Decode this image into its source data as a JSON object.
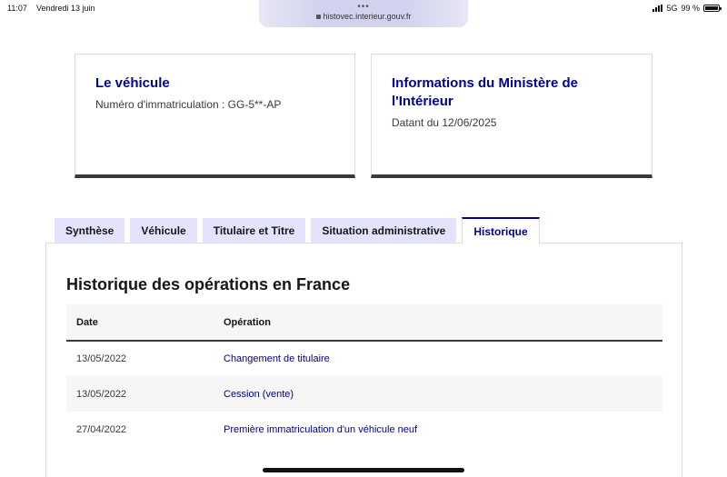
{
  "status_bar": {
    "time": "11:07",
    "date": "Vendredi 13 juin",
    "network": "5G",
    "battery": "99 %",
    "battery_level": 0.99
  },
  "browser": {
    "url": "histovec.interieur.gouv.fr",
    "dots": "•••"
  },
  "cards": {
    "vehicle": {
      "title": "Le véhicule",
      "text": "Numéro d'immatriculation : GG-5**-AP"
    },
    "ministry": {
      "title": "Informations du Ministère de l'Intérieur",
      "text": "Datant du 12/06/2025"
    }
  },
  "tabs": [
    {
      "label": "Synthèse",
      "active": false
    },
    {
      "label": "Véhicule",
      "active": false
    },
    {
      "label": "Titulaire et Titre",
      "active": false
    },
    {
      "label": "Situation administrative",
      "active": false
    },
    {
      "label": "Historique",
      "active": true
    }
  ],
  "history": {
    "title": "Historique des opérations en France",
    "columns": [
      "Date",
      "Opération"
    ],
    "rows": [
      {
        "date": "13/05/2022",
        "operation": "Changement de titulaire"
      },
      {
        "date": "13/05/2022",
        "operation": "Cession (vente)"
      },
      {
        "date": "27/04/2022",
        "operation": "Première immatriculation d'un véhicule neuf"
      }
    ]
  },
  "colors": {
    "accent": "#000091",
    "tab_background": "#e3e3fd",
    "row_alt": "#f6f6f6"
  }
}
